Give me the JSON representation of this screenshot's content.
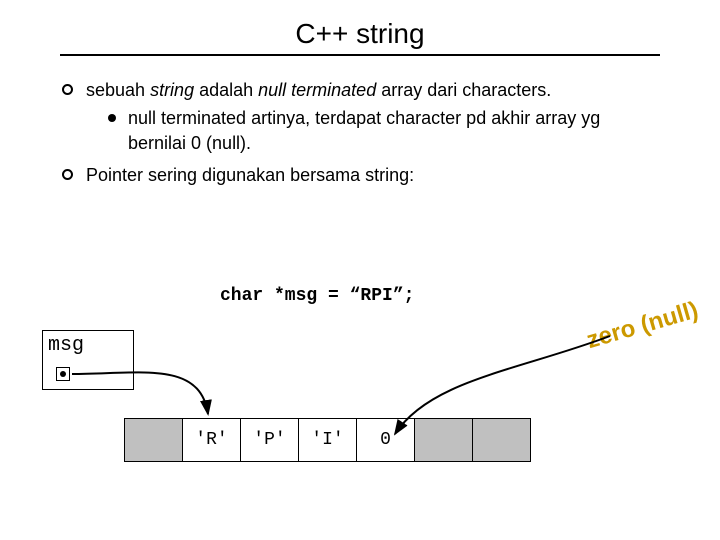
{
  "title": "C++ string",
  "bullets": {
    "b1_pre": "sebuah ",
    "b1_i1": "string",
    "b1_mid": " adalah ",
    "b1_i2": "null terminated",
    "b1_post": " array dari characters.",
    "b1_sub": "null terminated artinya, terdapat character pd akhir array yg bernilai 0 (null).",
    "b2": "Pointer sering digunakan bersama string:"
  },
  "code_line": "char *msg = “RPI”;",
  "msg_label": "msg",
  "cells": {
    "c0": "",
    "c1": "'R'",
    "c2": "'P'",
    "c3": "'I'",
    "c4": "0",
    "c5": "",
    "c6": ""
  },
  "annotation": "zero (null)"
}
